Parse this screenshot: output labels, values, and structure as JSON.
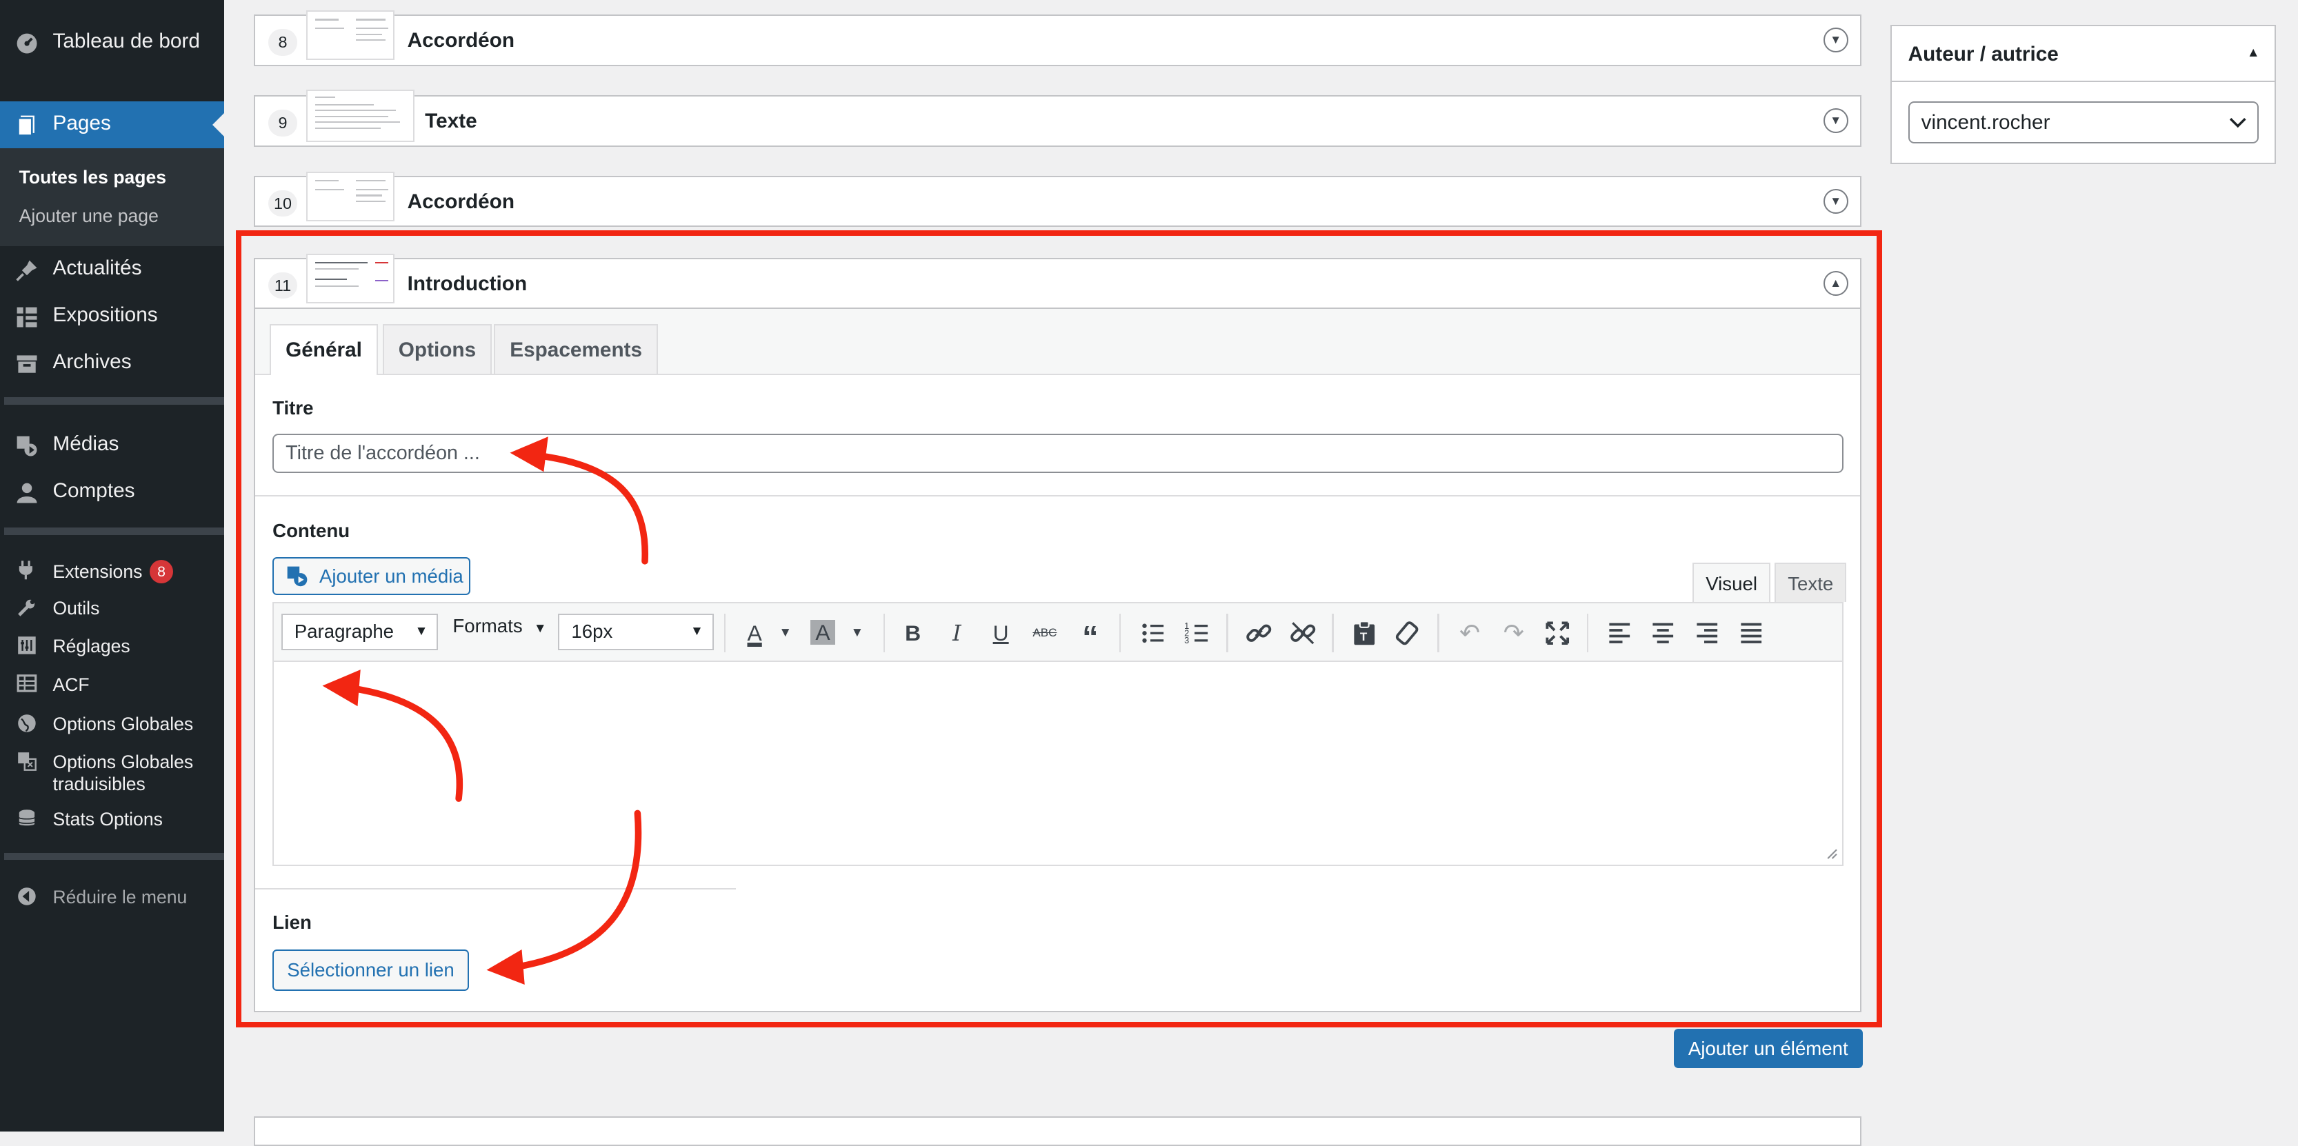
{
  "sidebar": {
    "dashboard": "Tableau de bord",
    "pages": "Pages",
    "pages_sub": [
      "Toutes les pages",
      "Ajouter une page"
    ],
    "posts": "Actualités",
    "expositions": "Expositions",
    "archives": "Archives",
    "media": "Médias",
    "accounts": "Comptes",
    "extensions": "Extensions",
    "extensions_badge": "8",
    "tools": "Outils",
    "settings": "Réglages",
    "acf": "ACF",
    "global_options": "Options Globales",
    "global_options_translatable_line1": "Options Globales",
    "global_options_translatable_line2": "traduisibles",
    "stats_options": "Stats Options",
    "collapse": "Réduire le menu"
  },
  "layouts": [
    {
      "num": "8",
      "title": "Accordéon"
    },
    {
      "num": "9",
      "title": "Texte"
    },
    {
      "num": "10",
      "title": "Accordéon"
    },
    {
      "num": "11",
      "title": "Introduction"
    }
  ],
  "editor_panel": {
    "tabs": [
      "Général",
      "Options",
      "Espacements"
    ],
    "title_label": "Titre",
    "title_placeholder": "Titre de l'accordéon ...",
    "content_label": "Contenu",
    "add_media": "Ajouter un média",
    "mode_visual": "Visuel",
    "mode_text": "Texte",
    "format_select": "Paragraphe",
    "formats_menu": "Formats",
    "font_size": "16px",
    "link_label": "Lien",
    "select_link": "Sélectionner un lien"
  },
  "add_element": "Ajouter un élément",
  "author_box": {
    "title": "Auteur / autrice",
    "selected": "vincent.rocher"
  },
  "colors": {
    "sidebar_bg": "#1d2327",
    "accent": "#2271b1",
    "annotation": "#f22612",
    "badge": "#d63638"
  }
}
